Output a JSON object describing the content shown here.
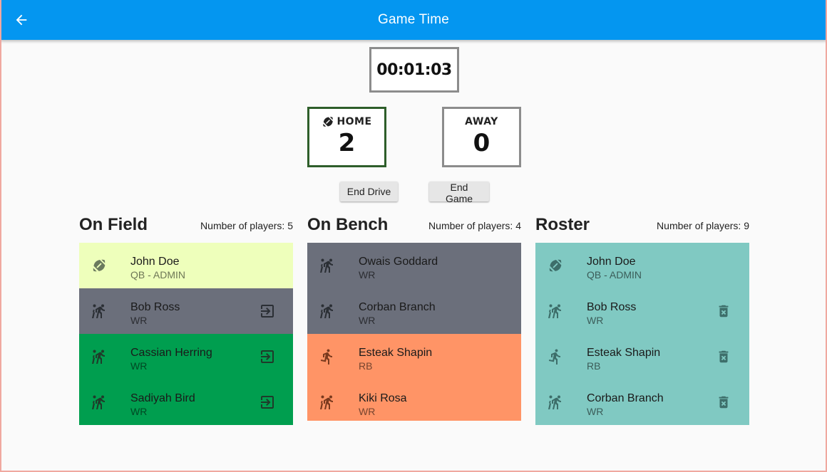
{
  "app": {
    "title": "Game Time"
  },
  "timer": {
    "value": "00:01:03"
  },
  "scoreboard": {
    "home": {
      "label": "HOME",
      "score": "2"
    },
    "away": {
      "label": "AWAY",
      "score": "0"
    }
  },
  "buttons": {
    "end_drive": "End Drive",
    "end_game": "End Game"
  },
  "on_field": {
    "title": "On Field",
    "count": "Number of players: 5",
    "rows": [
      {
        "name": "John Doe",
        "role": "QB - ADMIN"
      },
      {
        "name": "Bob Ross",
        "role": "WR"
      },
      {
        "name": "Cassian Herring",
        "role": "WR"
      },
      {
        "name": "Sadiyah Bird",
        "role": "WR"
      }
    ]
  },
  "on_bench": {
    "title": "On Bench",
    "count": "Number of players: 4",
    "rows": [
      {
        "name": "Owais Goddard",
        "role": "WR"
      },
      {
        "name": "Corban Branch",
        "role": "WR"
      },
      {
        "name": "Esteak Shapin",
        "role": "RB"
      },
      {
        "name": "Kiki Rosa",
        "role": "WR"
      }
    ]
  },
  "roster": {
    "title": "Roster",
    "count": "Number of players: 9",
    "rows": [
      {
        "name": "John Doe",
        "role": "QB - ADMIN"
      },
      {
        "name": "Bob Ross",
        "role": "WR"
      },
      {
        "name": "Esteak Shapin",
        "role": "RB"
      },
      {
        "name": "Corban Branch",
        "role": "WR"
      }
    ]
  },
  "colors": {
    "appbar": "#0496f0",
    "field_qb_row": "#eeffbb",
    "field_gray_row": "#6b6f7b",
    "field_green_row": "#009e4f",
    "bench_gray_row": "#6b6f7b",
    "bench_orange_row": "#ff9466",
    "roster_row": "#80c9c2",
    "home_border": "#2e5e2a",
    "away_border": "#8c8c8c"
  },
  "icons": {
    "back": "arrow-back-icon",
    "football": "football-icon",
    "sports": "sports-kabaddi-icon",
    "runner": "running-icon",
    "exit": "exit-to-app-icon",
    "delete": "delete-forever-icon"
  }
}
